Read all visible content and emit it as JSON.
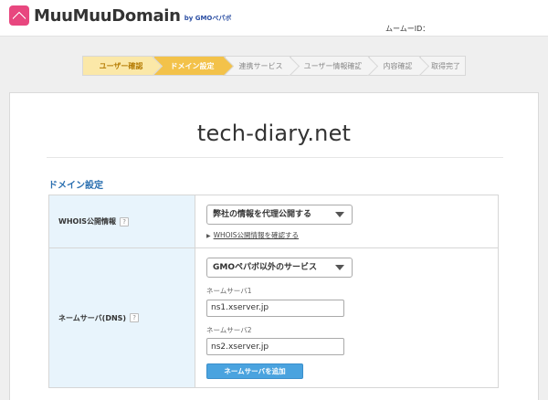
{
  "header": {
    "logo_text": "MuuMuuDomain",
    "logo_sub": "by GMOペパボ",
    "member_id_label": "ムームーID："
  },
  "steps": [
    {
      "label": "ユーザー確認",
      "state": "done"
    },
    {
      "label": "ドメイン設定",
      "state": "active"
    },
    {
      "label": "連携サービス",
      "state": "pending"
    },
    {
      "label": "ユーザー情報確認",
      "state": "pending"
    },
    {
      "label": "内容確認",
      "state": "pending"
    },
    {
      "label": "取得完了",
      "state": "pending"
    }
  ],
  "domain": "tech-diary.net",
  "section_title": "ドメイン設定",
  "whois": {
    "label": "WHOIS公開情報",
    "help": "?",
    "selected": "弊社の情報を代理公開する",
    "link": "WHOIS公開情報を確認する"
  },
  "dns": {
    "label": "ネームサーバ(DNS)",
    "help": "?",
    "selected": "GMOペパボ以外のサービス",
    "ns1_label": "ネームサーバ1",
    "ns1_value": "ns1.xserver.jp",
    "ns2_label": "ネームサーバ2",
    "ns2_value": "ns2.xserver.jp",
    "add_button": "ネームサーバを追加"
  },
  "colors": {
    "brand": "#e8477f",
    "step_active": "#f3c24a",
    "step_done": "#fbe8a8",
    "section_title": "#2a6fb0",
    "label_bg": "#e8f4fc",
    "button": "#4aa3df"
  }
}
